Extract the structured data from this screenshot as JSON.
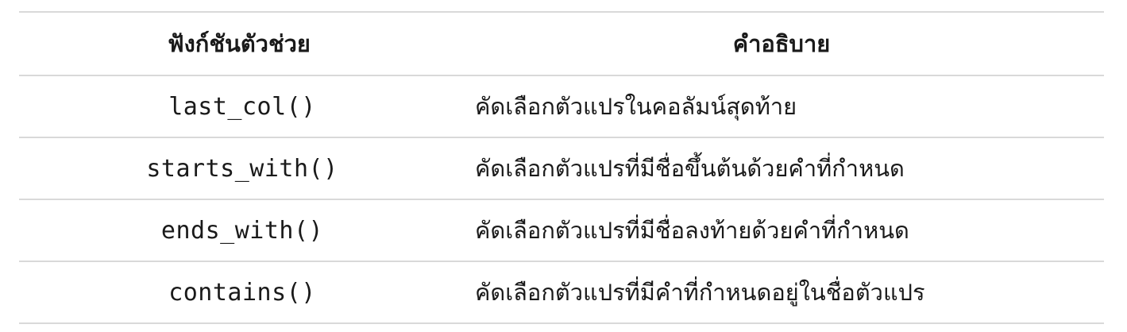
{
  "table": {
    "headers": {
      "function": "ฟังก์ชันตัวช่วย",
      "description": "คำอธิบาย"
    },
    "rows": [
      {
        "function": "last_col()",
        "description": "คัดเลือกตัวแปรในคอลัมน์สุดท้าย"
      },
      {
        "function": "starts_with()",
        "description": "คัดเลือกตัวแปรที่มีชื่อขึ้นต้นด้วยคำที่กำหนด"
      },
      {
        "function": "ends_with()",
        "description": "คัดเลือกตัวแปรที่มีชื่อลงท้ายด้วยคำที่กำหนด"
      },
      {
        "function": "contains()",
        "description": "คัดเลือกตัวแปรที่มีคำที่กำหนดอยู่ในชื่อตัวแปร"
      }
    ]
  }
}
